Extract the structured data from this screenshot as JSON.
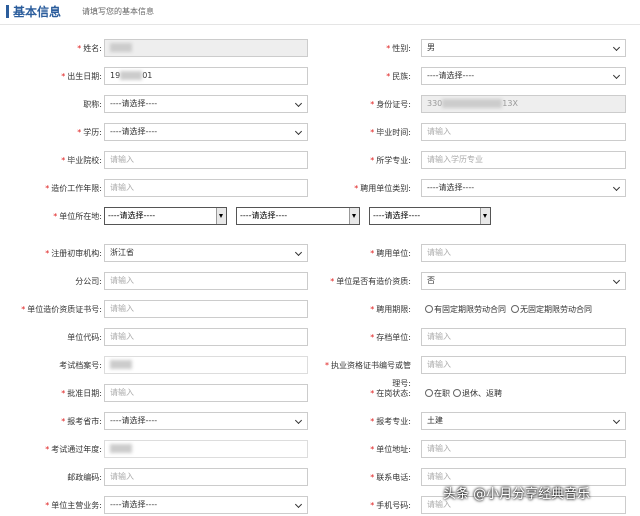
{
  "header": {
    "title": "基本信息",
    "subtitle": "请填写您的基本信息"
  },
  "row1": {
    "name_label": "姓名:",
    "name_value": "",
    "gender_label": "性别:",
    "gender_value": "男"
  },
  "row2": {
    "birth_label": "出生日期:",
    "birth_prefix": "19",
    "birth_suffix": "01",
    "ethnic_label": "民族:",
    "ethnic_value": "----请选择----"
  },
  "row3": {
    "title_label": "职称:",
    "title_value": "----请选择----",
    "id_label": "身份证号:",
    "id_prefix": "330",
    "id_suffix": "13X"
  },
  "row4": {
    "edu_label": "学历:",
    "edu_value": "----请选择----",
    "grad_time_label": "毕业时间:",
    "grad_time_placeholder": "请输入"
  },
  "row5": {
    "school_label": "毕业院校:",
    "school_placeholder": "请输入",
    "major_label": "所学专业:",
    "major_placeholder": "请输入学历专业"
  },
  "row6": {
    "years_label": "造价工作年限:",
    "years_placeholder": "请输入",
    "employer_type_label": "聘用单位类别:",
    "employer_type_value": "----请选择----"
  },
  "row7": {
    "location_label": "单位所在地:",
    "select1": "----请选择----",
    "select2": "----请选择----",
    "select3": "----请选择----"
  },
  "row8": {
    "reg_label": "注册初审机构:",
    "reg_value": "浙江省",
    "employer_label": "聘用单位:",
    "employer_placeholder": "请输入"
  },
  "row9": {
    "branch_label": "分公司:",
    "branch_placeholder": "请输入",
    "qual_label": "单位是否有造价资质:",
    "qual_value": "否"
  },
  "row10": {
    "cert_label": "单位造价资质证书号:",
    "cert_placeholder": "请输入",
    "period_label": "聘用期限:",
    "option1": "有固定期限劳动合同",
    "option2": "无固定期限劳动合同"
  },
  "row11": {
    "code_label": "单位代码:",
    "code_placeholder": "请输入",
    "archive_label": "存档单位:",
    "archive_placeholder": "请输入"
  },
  "row12": {
    "exam_no_label": "考试档案号:",
    "license_label_line1": "执业资格证书编号或管",
    "license_label_line2": "理号:",
    "license_placeholder": "请输入"
  },
  "row13": {
    "approve_label": "批准日期:",
    "approve_placeholder": "请输入",
    "status_label": "在岗状态:",
    "status_option1": "在职",
    "status_option2": "退休、返聘"
  },
  "row14": {
    "province_label": "报考省市:",
    "province_value": "----请选择----",
    "specialty_label": "报考专业:",
    "specialty_value": "土建"
  },
  "row15": {
    "pass_year_label": "考试通过年度:",
    "address_label": "单位地址:",
    "address_placeholder": "请输入"
  },
  "row16": {
    "zip_label": "邮政编码:",
    "zip_placeholder": "请输入",
    "phone_label": "联系电话:",
    "phone_placeholder": "请输入"
  },
  "row17": {
    "business_label": "单位主营业务:",
    "business_value": "----请选择----",
    "mobile_label": "手机号码:",
    "mobile_placeholder": "请输入"
  },
  "watermark": "头条 @小月分享经典音乐"
}
